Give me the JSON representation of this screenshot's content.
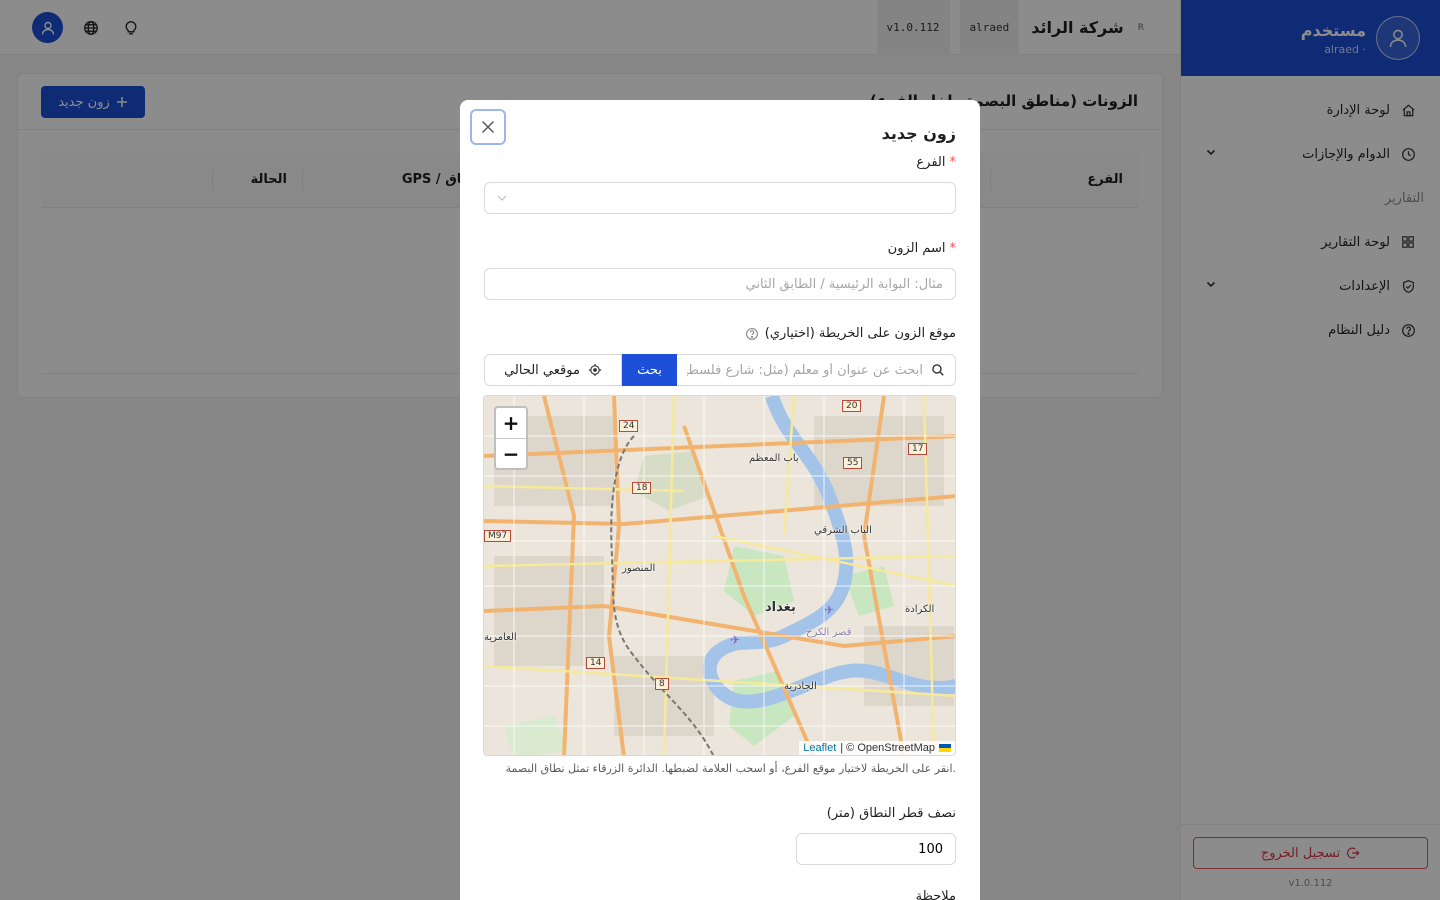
{
  "topbar": {
    "company": "شركة الرائد",
    "username_chip": "alraed",
    "version_chip": "v1.0.112",
    "small_mark": "R"
  },
  "sidebar": {
    "user_name": "مستخدم",
    "user_sub": "alraed ·",
    "items": [
      {
        "label": "لوحة الإدارة",
        "icon": "home-icon"
      },
      {
        "label": "الدوام والإجازات",
        "icon": "clock-icon"
      },
      {
        "label": "لوحة التقارير",
        "icon": "grid-icon"
      },
      {
        "label": "الإعدادات",
        "icon": "shield-check-icon"
      },
      {
        "label": "دليل النظام",
        "icon": "help-circle-icon"
      }
    ],
    "group_reports": "التقارير",
    "logout_label": "تسجيل الخروج",
    "version": "v1.0.112"
  },
  "page": {
    "title": "الزونات (مناطق البصمة داخل الفرع)",
    "new_button": "زون جديد",
    "columns": {
      "branch": "الفرع",
      "gps": "GPS / النطاق",
      "status": "الحالة"
    }
  },
  "modal": {
    "title": "زون جديد",
    "branch_label": "الفرع",
    "zone_name_label": "اسم الزون",
    "zone_name_placeholder": "مثال: البوابة الرئيسية / الطابق الثاني",
    "location_label": "موقع الزون على الخريطة (اختياري)",
    "search_placeholder": "ابحث عن عنوان أو معلم (مثل: شارع فلسطين)",
    "search_button": "بحث",
    "my_location_button": "موقعي الحالي",
    "map": {
      "attribution_leaflet": "Leaflet",
      "attribution_osm": "| © OpenStreetMap",
      "places": [
        "بغداد",
        "باب المعظم",
        "الباب الشرقي",
        "المنصور",
        "الكرادة",
        "العامرية",
        "الجادرية",
        "قصر الكرخ"
      ],
      "road_numbers": [
        "20",
        "24",
        "17",
        "55",
        "18",
        "M97",
        "14",
        "8"
      ]
    },
    "map_hint": "انقر على الخريطة لاختيار موقع الفرع، أو اسحب العلامة لضبطها. الدائرة الزرقاء تمثل نطاق البصمة.",
    "radius_label": "نصف قطر النطاق (متر)",
    "radius_value": "100",
    "note_label": "ملاحظة"
  },
  "colors": {
    "primary": "#1d4fd8",
    "danger": "#d9363e",
    "river": "#a3c4e8"
  }
}
